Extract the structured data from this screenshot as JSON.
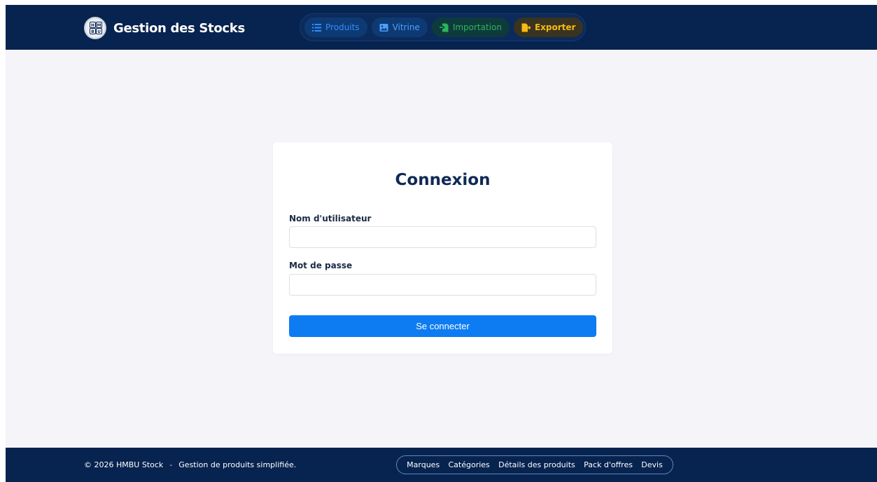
{
  "header": {
    "title": "Gestion des Stocks",
    "logo_letters": [
      "H",
      "M",
      "B",
      "U"
    ],
    "nav": [
      {
        "label": "Produits",
        "icon": "list-icon",
        "color": "#2f8dff"
      },
      {
        "label": "Vitrine",
        "icon": "image-icon",
        "color": "#4aa0ff"
      },
      {
        "label": "Importation",
        "icon": "file-import-icon",
        "color": "#2bb55a"
      },
      {
        "label": "Exporter",
        "icon": "file-export-icon",
        "color": "#f6b915"
      }
    ]
  },
  "login": {
    "title": "Connexion",
    "username_label": "Nom d'utilisateur",
    "username_value": "",
    "password_label": "Mot de passe",
    "password_value": "",
    "submit_label": "Se connecter",
    "submit_color": "#0d7cf2"
  },
  "footer": {
    "copyright": "© 2026 HMBU Stock",
    "separator": "-",
    "tagline": "Gestion de produits simplifiée.",
    "links": [
      "Marques",
      "Catégories",
      "Détails des produits",
      "Pack d'offres",
      "Devis"
    ]
  },
  "colors": {
    "navbar_bg": "#07234f",
    "page_bg": "#f4f4f9",
    "title_color": "#0f2a55"
  }
}
